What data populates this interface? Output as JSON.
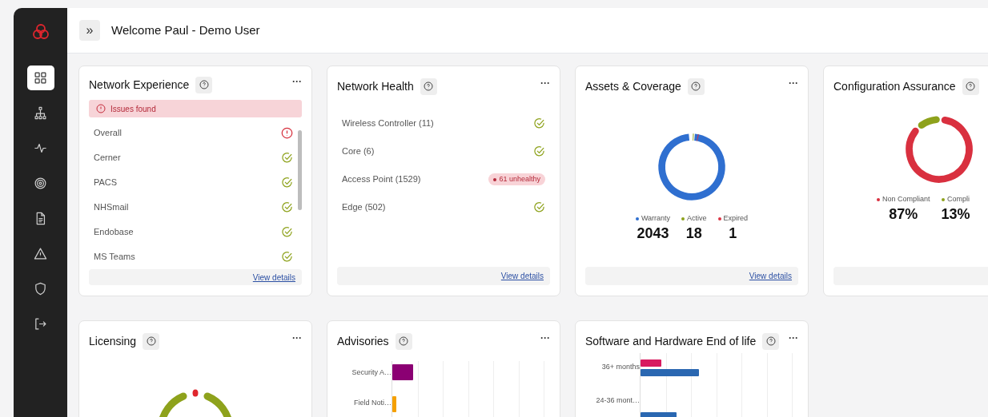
{
  "sidebar": {
    "items": [
      {
        "selected": true
      },
      {
        "selected": false
      },
      {
        "selected": false
      },
      {
        "selected": false
      },
      {
        "selected": false
      },
      {
        "selected": false
      },
      {
        "selected": false
      },
      {
        "selected": false
      }
    ]
  },
  "header": {
    "expand_button": "»",
    "title": "Welcome Paul - Demo User"
  },
  "cards": [
    {
      "kind": "status_list",
      "title": "Network Experience",
      "menu": "···",
      "banner": "Issues found",
      "rows": [
        {
          "label": "Overall",
          "kind": "issue"
        },
        {
          "label": "Cerner",
          "kind": "ok"
        },
        {
          "label": "PACS",
          "kind": "ok"
        },
        {
          "label": "NHSmail",
          "kind": "ok"
        },
        {
          "label": "Endobase",
          "kind": "ok"
        },
        {
          "label": "MS Teams",
          "kind": "ok"
        }
      ],
      "link": "View details"
    },
    {
      "kind": "health_list",
      "title": "Network Health",
      "menu": "···",
      "rows": [
        {
          "label": "Wireless Controller (11)",
          "kind": "ok"
        },
        {
          "label": "Core (6)",
          "kind": "ok"
        },
        {
          "label": "Access Point (1529)",
          "kind": "badge",
          "badge": "61 unhealthy"
        },
        {
          "label": "Edge (502)",
          "kind": "ok"
        }
      ],
      "link": "View details"
    },
    {
      "kind": "donut",
      "title": "Assets & Coverage",
      "menu": "···",
      "legend": [
        {
          "label": "Warranty",
          "value": "2043",
          "color": "#2f6fd0"
        },
        {
          "label": "Active",
          "value": "18",
          "color": "#8ea21c"
        },
        {
          "label": "Expired",
          "value": "1",
          "color": "#dc3545"
        }
      ],
      "link": "View details"
    },
    {
      "kind": "donut",
      "title": "Configuration Assurance",
      "legend": [
        {
          "label": "Non Compliant",
          "value": "87%",
          "color": "#d9303f"
        },
        {
          "label": "Compli",
          "value": "13%",
          "color": "#8ea21c"
        }
      ]
    },
    {
      "kind": "licensing",
      "title": "Licensing",
      "menu": "···"
    },
    {
      "kind": "bars",
      "title": "Advisories",
      "menu": "···",
      "categories": [
        "Security A…",
        "Field Noti…"
      ]
    },
    {
      "kind": "bars2",
      "title": "Software and Hardware End of life",
      "menu": "···",
      "categories": [
        "36+ months",
        "24-36 mont…"
      ]
    }
  ]
}
